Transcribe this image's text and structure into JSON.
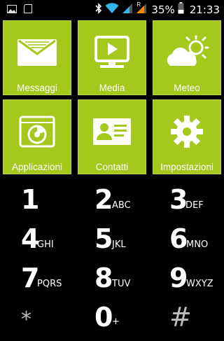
{
  "status": {
    "battery_percent": "35%",
    "time": "21:33",
    "roaming_mark": "R",
    "icons": [
      "image-icon",
      "sd-card-icon",
      "bluetooth-icon",
      "wifi-icon",
      "signal-icon",
      "signal-roaming-icon",
      "battery-icon"
    ]
  },
  "accent": "#a4c81c",
  "tiles": [
    {
      "label": "Messaggi",
      "icon": "envelope-icon"
    },
    {
      "label": "Media",
      "icon": "monitor-play-icon"
    },
    {
      "label": "Meteo",
      "icon": "weather-icon"
    },
    {
      "label": "Applicazioni",
      "icon": "apps-chart-icon"
    },
    {
      "label": "Contatti",
      "icon": "contact-card-icon"
    },
    {
      "label": "Impostazioni",
      "icon": "gear-icon"
    }
  ],
  "dialpad": [
    {
      "digit": "1",
      "letters": ""
    },
    {
      "digit": "2",
      "letters": "ABC"
    },
    {
      "digit": "3",
      "letters": "DEF"
    },
    {
      "digit": "4",
      "letters": "GHI"
    },
    {
      "digit": "5",
      "letters": "JKL"
    },
    {
      "digit": "6",
      "letters": "MNO"
    },
    {
      "digit": "7",
      "letters": "PQRS"
    },
    {
      "digit": "8",
      "letters": "TUV"
    },
    {
      "digit": "9",
      "letters": "WXYZ"
    },
    {
      "digit": "*",
      "letters": ""
    },
    {
      "digit": "0",
      "letters": "+"
    },
    {
      "digit": "#",
      "letters": ""
    }
  ]
}
